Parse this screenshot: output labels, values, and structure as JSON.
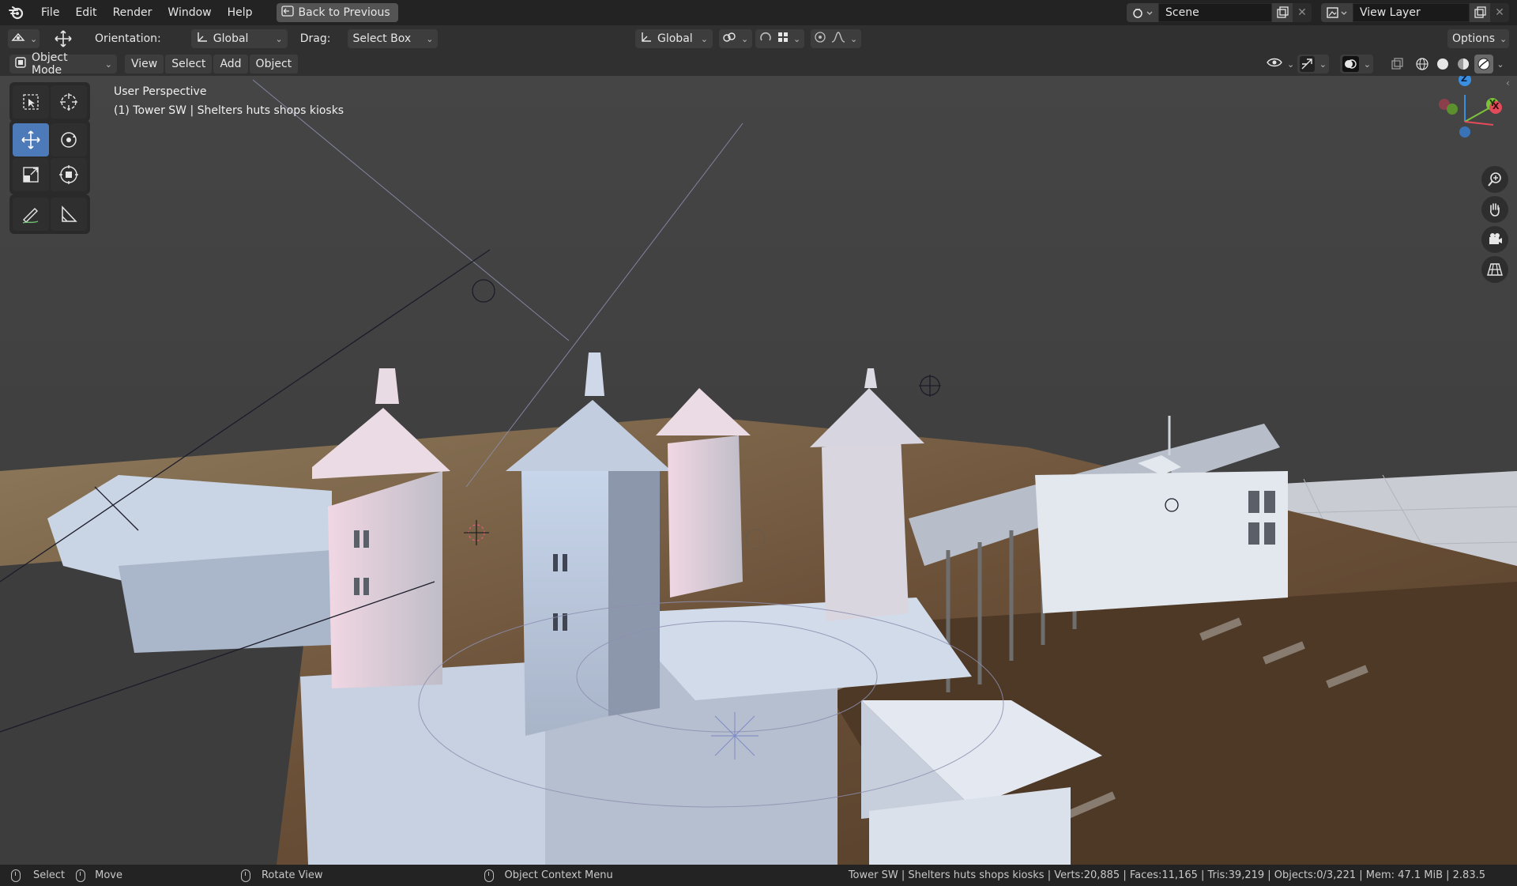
{
  "topbar": {
    "menus": [
      "File",
      "Edit",
      "Render",
      "Window",
      "Help"
    ],
    "back_label": "Back to Previous",
    "scene_label": "Scene",
    "view_layer_label": "View Layer"
  },
  "toolheader": {
    "orientation_label": "Orientation:",
    "orientation_value": "Global",
    "drag_label": "Drag:",
    "drag_value": "Select Box",
    "transform_value": "Global",
    "options_label": "Options"
  },
  "vpheader": {
    "mode_label": "Object Mode",
    "menus": [
      "View",
      "Select",
      "Add",
      "Object"
    ]
  },
  "viewport": {
    "perspective_label": "User Perspective",
    "object_info": "(1) Tower SW | Shelters huts shops kiosks",
    "gizmo_axes": {
      "z": "Z",
      "y": "Y",
      "x": "X"
    }
  },
  "statusbar": {
    "select_label": "Select",
    "move_label": "Move",
    "rotate_label": "Rotate View",
    "context_label": "Object Context Menu",
    "stats": "Tower SW | Shelters huts shops kiosks | Verts:20,885 | Faces:11,165 | Tris:39,219 | Objects:0/3,221 | Mem: 47.1 MiB | 2.83.5"
  },
  "colors": {
    "accent": "#4d7ab8",
    "axis_x": "#e34a5a",
    "axis_y": "#7dc33a",
    "axis_z": "#3a8fe0"
  }
}
